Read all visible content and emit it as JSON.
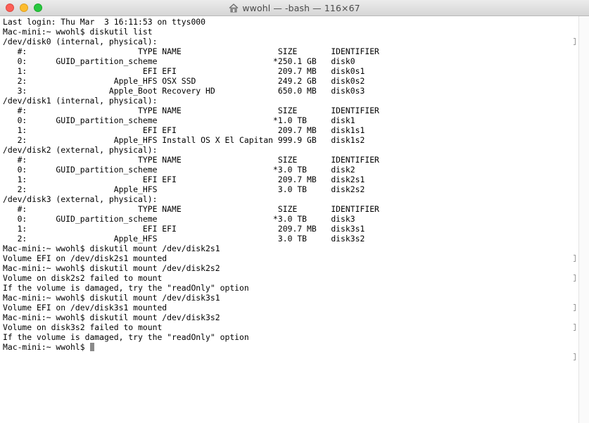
{
  "window": {
    "title": "wwohl — -bash — 116×67",
    "title_icon": "home-folder-icon"
  },
  "terminal": {
    "lines": [
      "Last login: Thu Mar  3 16:11:53 on ttys000",
      "Mac-mini:~ wwohl$ diskutil list",
      "/dev/disk0 (internal, physical):",
      "   #:                       TYPE NAME                    SIZE       IDENTIFIER",
      "   0:      GUID_partition_scheme                        *250.1 GB   disk0",
      "   1:                        EFI EFI                     209.7 MB   disk0s1",
      "   2:                  Apple_HFS OSX SSD                 249.2 GB   disk0s2",
      "   3:                 Apple_Boot Recovery HD             650.0 MB   disk0s3",
      "/dev/disk1 (internal, physical):",
      "   #:                       TYPE NAME                    SIZE       IDENTIFIER",
      "   0:      GUID_partition_scheme                        *1.0 TB     disk1",
      "   1:                        EFI EFI                     209.7 MB   disk1s1",
      "   2:                  Apple_HFS Install OS X El Capitan 999.9 GB   disk1s2",
      "/dev/disk2 (external, physical):",
      "   #:                       TYPE NAME                    SIZE       IDENTIFIER",
      "   0:      GUID_partition_scheme                        *3.0 TB     disk2",
      "   1:                        EFI EFI                     209.7 MB   disk2s1",
      "   2:                  Apple_HFS                         3.0 TB     disk2s2",
      "/dev/disk3 (external, physical):",
      "   #:                       TYPE NAME                    SIZE       IDENTIFIER",
      "   0:      GUID_partition_scheme                        *3.0 TB     disk3",
      "   1:                        EFI EFI                     209.7 MB   disk3s1",
      "   2:                  Apple_HFS                         3.0 TB     disk3s2",
      "Mac-mini:~ wwohl$ diskutil mount /dev/disk2s1",
      "Volume EFI on /dev/disk2s1 mounted",
      "Mac-mini:~ wwohl$ diskutil mount /dev/disk2s2",
      "Volume on disk2s2 failed to mount",
      "If the volume is damaged, try the \"readOnly\" option",
      "Mac-mini:~ wwohl$ diskutil mount /dev/disk3s1",
      "Volume EFI on /dev/disk3s1 mounted",
      "Mac-mini:~ wwohl$ diskutil mount /dev/disk3s2",
      "Volume on disk3s2 failed to mount",
      "If the volume is damaged, try the \"readOnly\" option",
      "Mac-mini:~ wwohl$ "
    ],
    "prompt_lines": [
      1,
      23,
      25,
      28,
      30,
      33
    ],
    "cursor_line": 33
  },
  "colors": {
    "text": "#000000",
    "cursor": "#8a8a8a",
    "close": "#fc5f57",
    "minimize": "#fdbc2e",
    "zoom": "#28c840"
  }
}
